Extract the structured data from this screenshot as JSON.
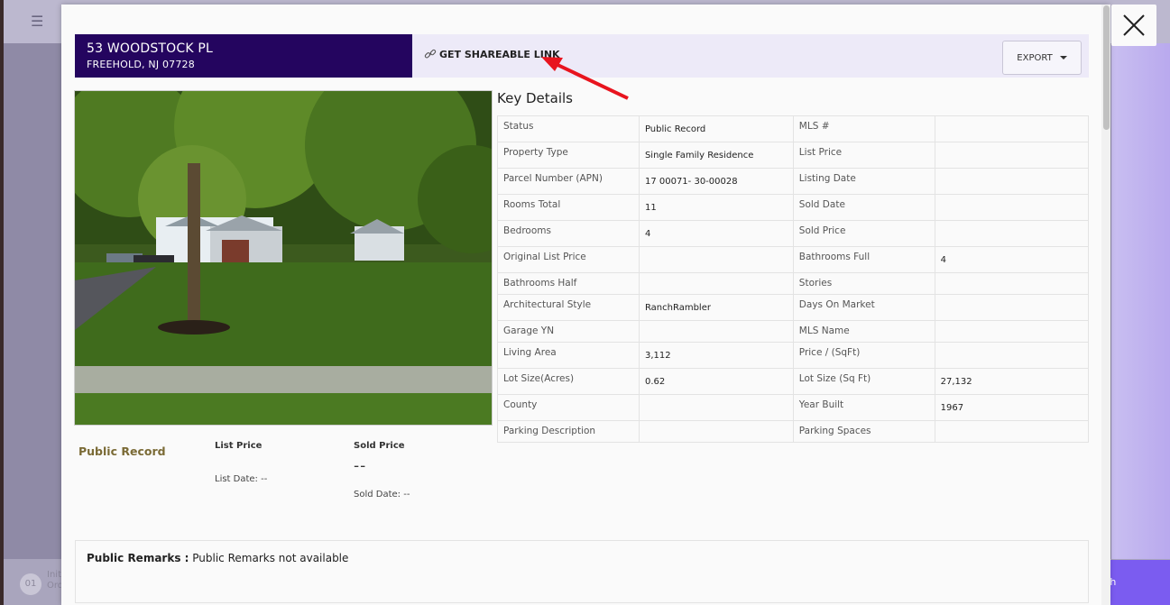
{
  "property": {
    "street": "53 WOODSTOCK PL",
    "city_state_zip": "FREEHOLD, NJ 07728"
  },
  "toolbar": {
    "share_label": "GET SHAREABLE LINK",
    "export_label": "EXPORT"
  },
  "key_details": {
    "title": "Key Details",
    "rows": [
      {
        "l1": "Status",
        "v1": "Public Record",
        "l2": "MLS #",
        "v2": ""
      },
      {
        "l1": "Property Type",
        "v1": "Single Family Residence",
        "l2": "List Price",
        "v2": ""
      },
      {
        "l1": "Parcel Number (APN)",
        "v1": "17 00071- 30-00028",
        "l2": "Listing Date",
        "v2": ""
      },
      {
        "l1": "Rooms Total",
        "v1": "11",
        "l2": "Sold Date",
        "v2": ""
      },
      {
        "l1": "Bedrooms",
        "v1": "4",
        "l2": "Sold Price",
        "v2": ""
      },
      {
        "l1": "Original List Price",
        "v1": "",
        "l2": "Bathrooms Full",
        "v2": "4"
      },
      {
        "l1": "Bathrooms Half",
        "v1": "",
        "l2": "Stories",
        "v2": ""
      },
      {
        "l1": "Architectural Style",
        "v1": "RanchRambler",
        "l2": "Days On Market",
        "v2": ""
      },
      {
        "l1": "Garage YN",
        "v1": "",
        "l2": "MLS Name",
        "v2": ""
      },
      {
        "l1": "Living Area",
        "v1": "3,112",
        "l2": "Price / (SqFt)",
        "v2": ""
      },
      {
        "l1": "Lot Size(Acres)",
        "v1": "0.62",
        "l2": "Lot Size (Sq Ft)",
        "v2": "27,132"
      },
      {
        "l1": "County",
        "v1": "",
        "l2": "Year Built",
        "v2": "1967"
      },
      {
        "l1": "Parking Description",
        "v1": "",
        "l2": "Parking Spaces",
        "v2": ""
      }
    ]
  },
  "summary": {
    "status": "Public Record",
    "list_price_label": "List Price",
    "list_date": "List Date: --",
    "sold_price_label": "Sold Price",
    "sold_price_value": "--",
    "sold_date": "Sold Date: --"
  },
  "remarks": {
    "label": "Public Remarks :",
    "text": " Public Remarks not available"
  },
  "background": {
    "step_number": "01",
    "step_text_1": "Init",
    "step_text_2": "Ord",
    "search_button": "rch"
  },
  "colors": {
    "address_bg": "#24055f",
    "share_bar_bg": "#edeaf8",
    "status_color": "#7a6a35",
    "annotation_arrow": "#e8141e"
  }
}
